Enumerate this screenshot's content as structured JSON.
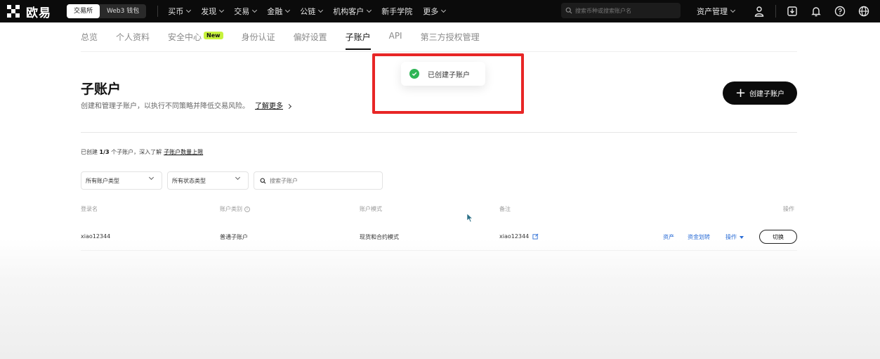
{
  "nav": {
    "logo": "欧易",
    "mode_exchange": "交易所",
    "mode_web3": "Web3 钱包",
    "items": [
      "买币",
      "发现",
      "交易",
      "金融",
      "公链",
      "机构客户",
      "新手学院",
      "更多"
    ],
    "search_placeholder": "搜索币种或搜索账户名",
    "asset_menu": "资产管理"
  },
  "tabs": [
    {
      "label": "总览"
    },
    {
      "label": "个人资料"
    },
    {
      "label": "安全中心",
      "badge": "New"
    },
    {
      "label": "身份认证"
    },
    {
      "label": "偏好设置"
    },
    {
      "label": "子账户",
      "active": true
    },
    {
      "label": "API"
    },
    {
      "label": "第三方授权管理"
    }
  ],
  "toast": {
    "text": "已创建子账户"
  },
  "page": {
    "title": "子账户",
    "description": "创建和管理子账户，以执行不同策略并降低交易风险。",
    "learn_more": "了解更多",
    "create_button": "创建子账户"
  },
  "summary": {
    "prefix": "已创建",
    "count": "1/3",
    "suffix": "个子账户，深入了解",
    "link": "子账户数量上限"
  },
  "filters": {
    "account_type": "所有账户类型",
    "status_type": "所有状态类型",
    "search_placeholder": "搜索子账户"
  },
  "table": {
    "headers": [
      "登录名",
      "账户类别",
      "账户模式",
      "备注",
      "操作"
    ],
    "rows": [
      {
        "login": "xiao12344",
        "category": "普通子账户",
        "mode": "现货和合约模式",
        "note": "xiao12344",
        "actions": [
          "资产",
          "资金划转",
          "操作"
        ],
        "switch_label": "切换"
      }
    ]
  },
  "colors": {
    "nav_bg": "#0b0b0b",
    "accent_green": "#c7f23d",
    "success": "#2fb556",
    "link_blue": "#2b6dd6",
    "highlight_red": "#e82626"
  }
}
